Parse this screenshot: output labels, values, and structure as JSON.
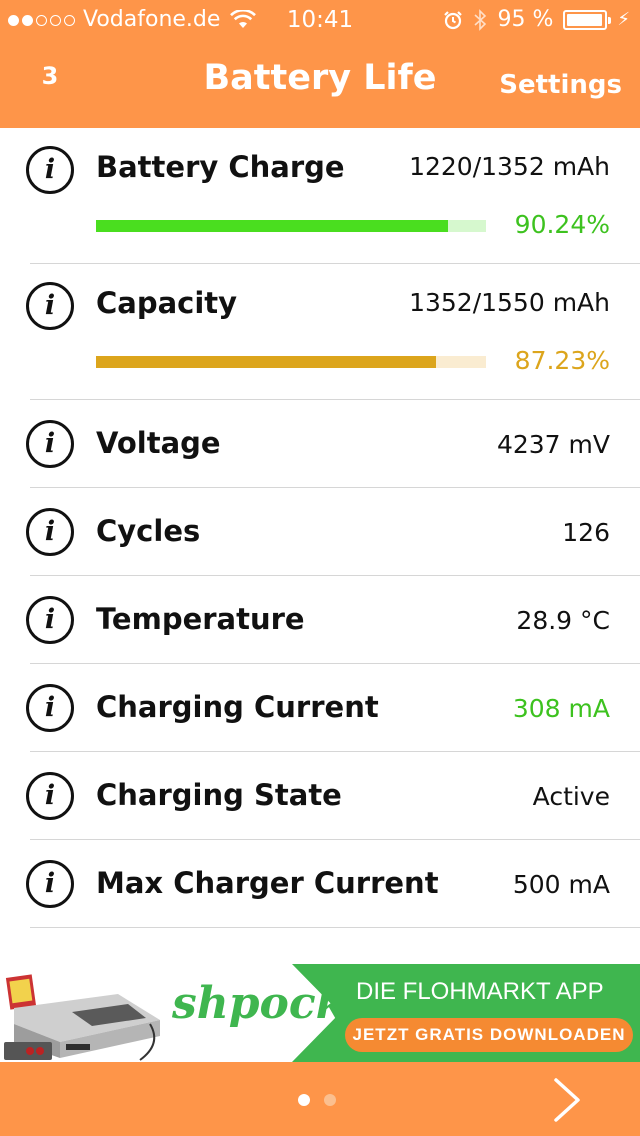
{
  "status_bar": {
    "carrier": "Vodafone.de",
    "signal_strength": 2,
    "signal_max": 5,
    "time": "10:41",
    "battery_percent": "95 %",
    "battery_level": 0.95,
    "icons": [
      "wifi-icon",
      "alarm-icon",
      "bluetooth-icon",
      "battery-icon",
      "charging-bolt-icon"
    ]
  },
  "nav": {
    "left_label": "3",
    "title": "Battery Life",
    "right_label": "Settings"
  },
  "rows": [
    {
      "label": "Battery Charge",
      "value": "1220/1352 mAh",
      "percent_text": "90.24%",
      "percent": 90.24,
      "bar_color": "#4ade1f",
      "bar_track": "#d6f8ce",
      "percent_color": "#3dc21f"
    },
    {
      "label": "Capacity",
      "value": "1352/1550 mAh",
      "percent_text": "87.23%",
      "percent": 87.23,
      "bar_color": "#dca51c",
      "bar_track": "#faecd1",
      "percent_color": "#dca51c"
    },
    {
      "label": "Voltage",
      "value": "4237 mV"
    },
    {
      "label": "Cycles",
      "value": "126"
    },
    {
      "label": "Temperature",
      "value": "28.9 °C"
    },
    {
      "label": "Charging Current",
      "value": "308 mA",
      "value_color": "#3dc21f"
    },
    {
      "label": "Charging State",
      "value": "Active"
    },
    {
      "label": "Max Charger Current",
      "value": "500 mA"
    }
  ],
  "ad": {
    "brand": "shpock",
    "headline": "DIE FLOHMARKT APP",
    "cta": "JETZT GRATIS DOWNLOADEN"
  },
  "toolbar": {
    "page_index": 1,
    "page_count": 2
  },
  "colors": {
    "accent": "#fe9549",
    "ad_green": "#3fb64f",
    "ad_orange": "#f58a32"
  }
}
